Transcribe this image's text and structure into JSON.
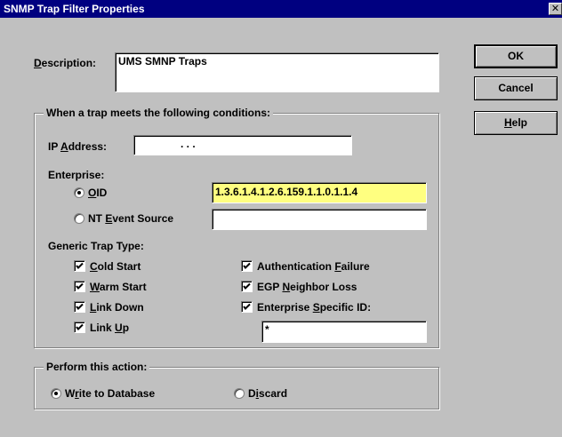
{
  "window": {
    "title": "SNMP Trap Filter Properties",
    "close_glyph": "✕"
  },
  "description": {
    "label": "Description:",
    "value": "UMS SMNP Traps"
  },
  "buttons": {
    "ok": "OK",
    "cancel": "Cancel",
    "help": "Help"
  },
  "conditions": {
    "group_title": "When a trap meets the following conditions:",
    "ip_label": "IP Address:",
    "ip_dots": ".            .            .",
    "enterprise_label": "Enterprise:",
    "oid": {
      "label": "OID",
      "value": "1.3.6.1.4.1.2.6.159.1.1.0.1.1.4",
      "selected": true,
      "highlight": "#ffff80"
    },
    "nt_event": {
      "label": "NT Event Source",
      "value": "",
      "selected": false
    }
  },
  "generic_trap_type": {
    "label": "Generic Trap Type:",
    "items": [
      {
        "label": "Cold Start",
        "checked": true
      },
      {
        "label": "Warm Start",
        "checked": true
      },
      {
        "label": "Link Down",
        "checked": true
      },
      {
        "label": "Link Up",
        "checked": true
      },
      {
        "label": "Authentication Failure",
        "checked": true
      },
      {
        "label": "EGP Neighbor Loss",
        "checked": true
      },
      {
        "label": "Enterprise Specific ID:",
        "checked": true
      }
    ],
    "enterprise_specific_value": "*"
  },
  "action": {
    "group_title": "Perform this action:",
    "write": {
      "label": "Write to Database",
      "selected": true
    },
    "discard": {
      "label": "Discard",
      "selected": false
    }
  }
}
